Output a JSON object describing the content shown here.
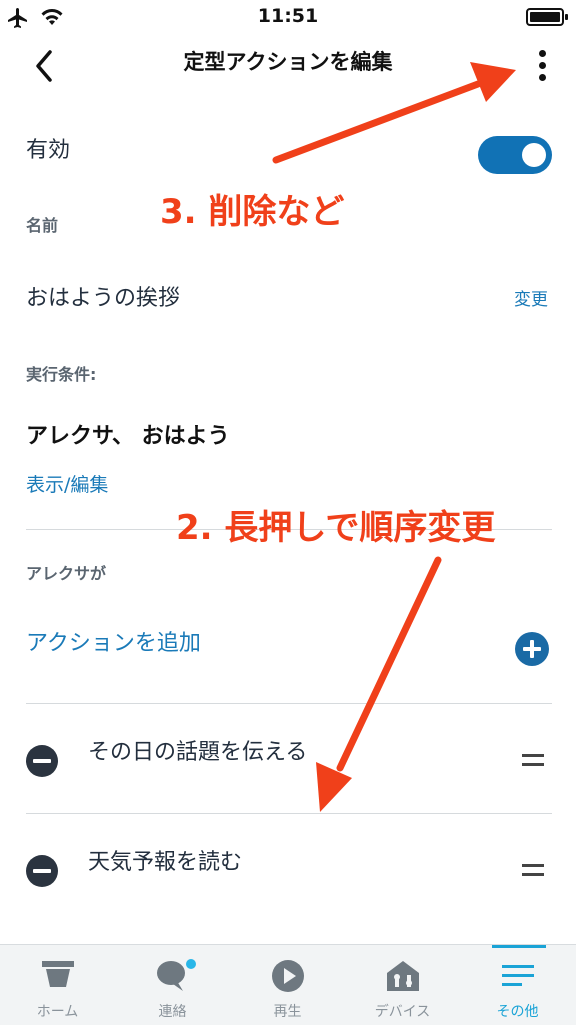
{
  "status_bar": {
    "time": "11:51"
  },
  "header": {
    "title": "定型アクションを編集"
  },
  "enable_row": {
    "label": "有効",
    "enabled": true
  },
  "name_section": {
    "label": "名前",
    "value": "おはようの挨拶",
    "change_link": "変更"
  },
  "condition_section": {
    "label": "実行条件:",
    "value": "アレクサ、 おはよう",
    "edit_link": "表示/編集"
  },
  "actions_section": {
    "label": "アレクサが",
    "add_action": "アクションを追加",
    "items": [
      {
        "text": "その日の話題を伝える"
      },
      {
        "text": "天気予報を読む"
      }
    ]
  },
  "annotations": {
    "delete_note": "3. 削除など",
    "reorder_note": "2. 長押しで順序変更"
  },
  "tab_bar": {
    "tabs": [
      {
        "label": "ホーム",
        "icon": "home-icon"
      },
      {
        "label": "連絡",
        "icon": "chat-icon"
      },
      {
        "label": "再生",
        "icon": "play-icon"
      },
      {
        "label": "デバイス",
        "icon": "devices-icon"
      },
      {
        "label": "その他",
        "icon": "menu-icon"
      }
    ],
    "active_index": 4
  },
  "colors": {
    "accent": "#1a7ab8",
    "toggle": "#1172b5",
    "annotation": "#f0401a",
    "tab_active": "#1aa3d6"
  }
}
